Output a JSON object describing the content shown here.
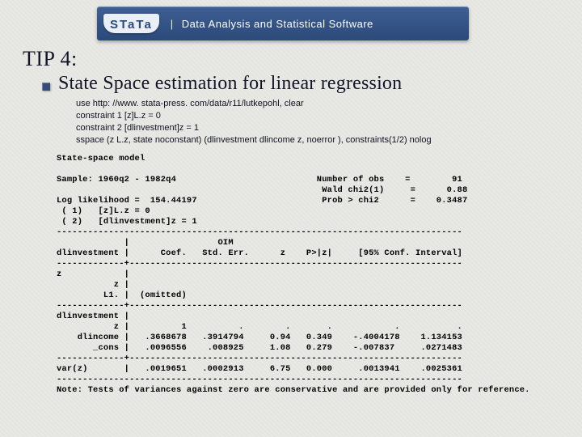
{
  "logo": {
    "mark": "STaTa",
    "tagline": "Data Analysis and Statistical Software"
  },
  "tip_heading": "TIP 4:",
  "subtitle": "State Space estimation for linear regression",
  "commands": {
    "l1": "use http: //www. stata-press. com/data/r11/lutkepohl, clear",
    "l2": "constraint 1 [z]L.z = 0",
    "l3": "constraint 2 [dlinvestment]z  = 1",
    "l4": "sspace  (z  L.z, state noconstant) (dlinvestment dlincome z, noerror ), constraints(1/2) nolog"
  },
  "out": {
    "title": "State-space model",
    "sample": "Sample: 1960q2 - 1982q4                           Number of obs    =        91",
    "wald": "                                                   Wald chi2(1)     =      0.88",
    "ll": "Log likelihood =  154.44197                        Prob > chi2      =    0.3487",
    "c1": " ( 1)   [z]L.z = 0",
    "c2": " ( 2)   [dlinvestment]z = 1",
    "rule": "------------------------------------------------------------------------------",
    "hdr1": "             |                 OIM",
    "hdr2": "dlinvestment |      Coef.   Std. Err.      z    P>|z|     [95% Conf. Interval]",
    "rule2": "-------------+----------------------------------------------------------------",
    "zsec": "z            |",
    "zrow": "           z |",
    "zl1": "         L1. |  (omitted)",
    "dlsec": "dlinvestment |",
    "dlz": "           z |          1          .        .       .            .           .",
    "dlinc": "    dlincome |   .3668678   .3914794     0.94   0.349    -.4004178    1.134153",
    "cons": "       _cons |   .0096556    .008925     1.08   0.279    -.007837     .0271483",
    "varz": "var(z)       |   .0019651   .0002913     6.75   0.000     .0013941    .0025361",
    "note": "Note: Tests of variances against zero are conservative and are provided only for reference."
  }
}
